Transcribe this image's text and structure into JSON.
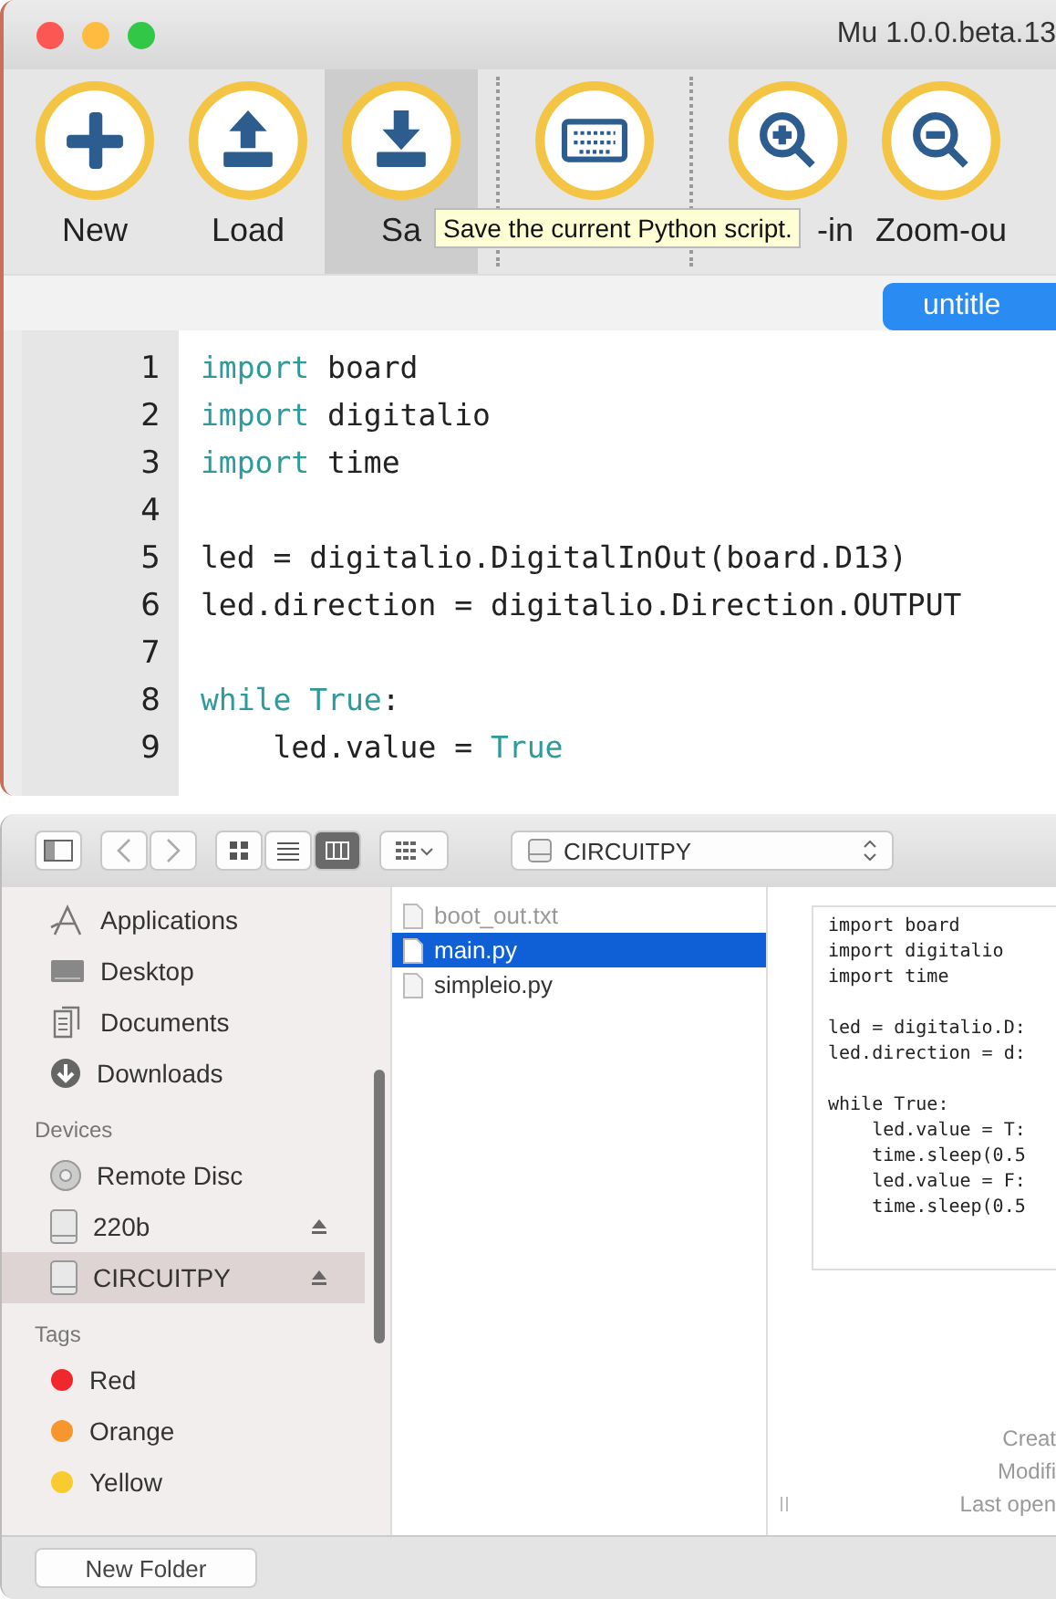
{
  "editor_window": {
    "title": "Mu 1.0.0.beta.13",
    "toolbar": [
      {
        "kind": "plus",
        "label": "New",
        "hovered": false
      },
      {
        "kind": "upload",
        "label": "Load",
        "hovered": false
      },
      {
        "kind": "download",
        "label": "Sa",
        "hovered": true
      },
      {
        "kind": "keyboard",
        "hovered": false
      },
      {
        "kind": "zoomin",
        "label": "-in",
        "hovered": false
      },
      {
        "kind": "zoomout",
        "label": "Zoom-ou",
        "hovered": false
      }
    ],
    "tooltip": "Save the current Python script.",
    "tab": {
      "label": "untitle",
      "selected": true
    },
    "code_lines": [
      {
        "number": "1",
        "tokens": [
          {
            "text": "import",
            "kind": "keyword"
          },
          {
            "text": " board",
            "kind": "plain"
          }
        ]
      },
      {
        "number": "2",
        "tokens": [
          {
            "text": "import",
            "kind": "keyword"
          },
          {
            "text": " digitalio",
            "kind": "plain"
          }
        ]
      },
      {
        "number": "3",
        "tokens": [
          {
            "text": "import",
            "kind": "keyword"
          },
          {
            "text": " time",
            "kind": "plain"
          }
        ]
      },
      {
        "number": "4"
      },
      {
        "number": "5",
        "tokens": [
          {
            "text": "led = digitalio.DigitalInOut(board.D13)",
            "kind": "plain"
          }
        ]
      },
      {
        "number": "6",
        "tokens": [
          {
            "text": "led.direction = digitalio.Direction.OUTPUT",
            "kind": "plain"
          }
        ]
      },
      {
        "number": "7"
      },
      {
        "number": "8",
        "tokens": [
          {
            "text": "while True",
            "kind": "keyword"
          },
          {
            "text": ":",
            "kind": "plain"
          }
        ]
      },
      {
        "number": "9",
        "tokens": [
          {
            "text": "    led.value = ",
            "kind": "plain"
          },
          {
            "text": "True",
            "kind": "keyword"
          }
        ]
      }
    ]
  },
  "finder_window": {
    "toolbar": {
      "views": [
        {
          "kind": "icons",
          "selected": false
        },
        {
          "kind": "list",
          "selected": false
        },
        {
          "kind": "columns",
          "selected": true
        }
      ],
      "location": "CIRCUITPY"
    },
    "sidebar": [
      {
        "items": [
          {
            "label": "Applications",
            "kind": "applications",
            "selected": false,
            "eject": false
          },
          {
            "label": "Desktop",
            "kind": "desktop",
            "selected": false,
            "eject": false
          },
          {
            "label": "Documents",
            "kind": "documents",
            "selected": false,
            "eject": false
          },
          {
            "label": "Downloads",
            "kind": "downloads",
            "selected": false,
            "eject": false
          }
        ]
      },
      {
        "heading": "Devices",
        "items": [
          {
            "label": "Remote Disc",
            "kind": "disc",
            "selected": false,
            "eject": false
          },
          {
            "label": "220b",
            "kind": "drive",
            "selected": false,
            "eject": true
          },
          {
            "label": "CIRCUITPY",
            "kind": "drive",
            "selected": true,
            "eject": true
          }
        ]
      },
      {
        "heading": "Tags",
        "items": [
          {
            "label": "Red",
            "kind": "tag",
            "color": "#f0282d",
            "selected": false,
            "eject": false
          },
          {
            "label": "Orange",
            "kind": "tag",
            "color": "#f7962c",
            "selected": false,
            "eject": false
          },
          {
            "label": "Yellow",
            "kind": "tag",
            "color": "#f8cb2e",
            "selected": false,
            "eject": false
          }
        ]
      }
    ],
    "files": [
      {
        "name": "boot_out.txt",
        "selected": false,
        "dimmed": true
      },
      {
        "name": "main.py",
        "selected": true,
        "dimmed": false
      },
      {
        "name": "simpleio.py",
        "selected": false,
        "dimmed": false
      }
    ],
    "preview_blocks": [
      [
        "import board",
        "import digitalio",
        "import time"
      ],
      [
        "led = digitalio.D:",
        "led.direction = d:"
      ],
      [
        "while True:",
        "    led.value = T:",
        "    time.sleep(0.5",
        "    led.value = F:",
        "    time.sleep(0.5"
      ]
    ],
    "info_labels": [
      "Creat",
      "Modifi",
      "Last open"
    ],
    "new_folder_button": "New Folder"
  }
}
